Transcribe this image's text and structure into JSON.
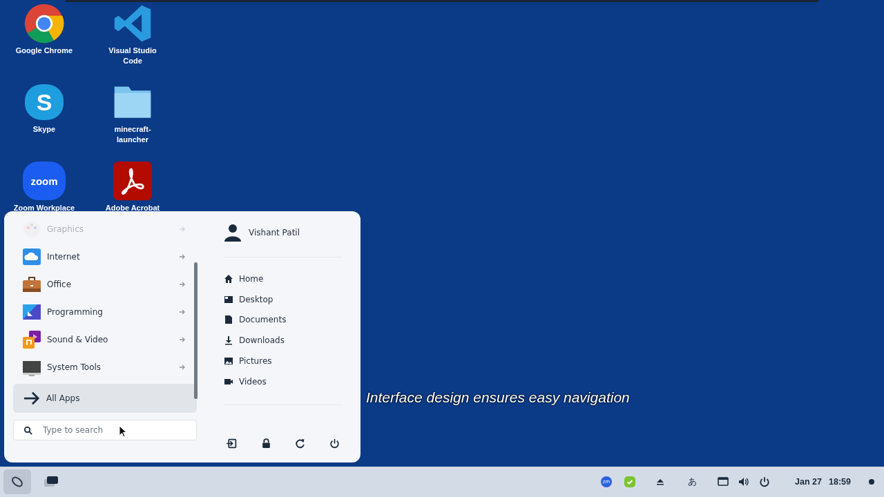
{
  "desktop_icons": [
    {
      "label": "Google Chrome"
    },
    {
      "label": "Visual Studio Code"
    },
    {
      "label": "Skype",
      "logo": "S"
    },
    {
      "label": "minecraft-launcher"
    },
    {
      "label": "Zoom Workplace",
      "logo": "zoom"
    },
    {
      "label": "Adobe Acrobat"
    }
  ],
  "caption": "Interface design ensures easy navigation",
  "menu": {
    "categories": [
      {
        "label": "Graphics",
        "faded": true
      },
      {
        "label": "Internet",
        "faded": false
      },
      {
        "label": "Office",
        "faded": false
      },
      {
        "label": "Programming",
        "faded": false
      },
      {
        "label": "Sound & Video",
        "faded": false
      },
      {
        "label": "System Tools",
        "faded": false
      }
    ],
    "all_apps": {
      "label": "All Apps",
      "selected": true
    },
    "search": {
      "placeholder": "Type to search"
    },
    "user": "Vishant Patil",
    "places": [
      "Home",
      "Desktop",
      "Documents",
      "Downloads",
      "Pictures",
      "Videos"
    ]
  },
  "taskbar": {
    "tray_zoom": "zm",
    "input_method": "あ",
    "date": "Jan 27",
    "time": "18:59"
  }
}
